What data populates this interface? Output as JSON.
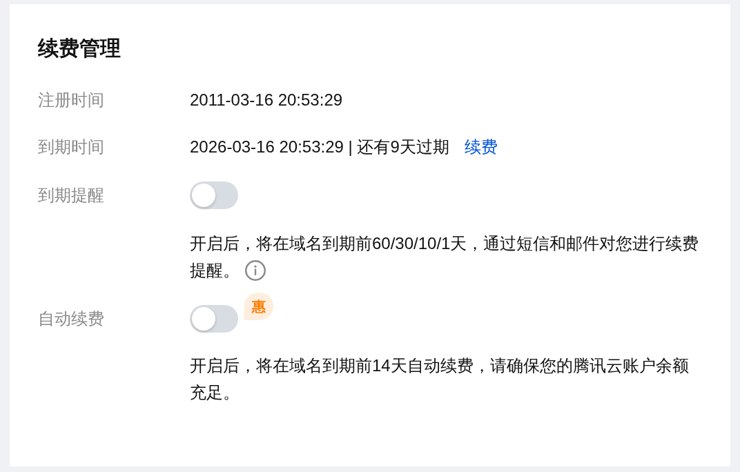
{
  "page": {
    "title": "续费管理"
  },
  "fields": [
    {
      "kind": "text",
      "label": "注册时间",
      "value": "2011-03-16 20:53:29"
    },
    {
      "kind": "text",
      "label": "到期时间",
      "value": "2026-03-16 20:53:29 | 还有9天过期",
      "link": "续费"
    },
    {
      "kind": "switch",
      "label": "到期提醒",
      "on": false,
      "description_lines": [
        "开启后，将在域名到期前60/30/10/1天，通过短信和邮件对您进行续费",
        "提醒。"
      ],
      "info": true
    },
    {
      "kind": "switch",
      "label": "自动续费",
      "on": false,
      "badge": "惠",
      "description_lines": [
        "开启后，将在域名到期前14天自动续费，请确保您的腾讯云账户余额",
        "充足。"
      ]
    }
  ]
}
